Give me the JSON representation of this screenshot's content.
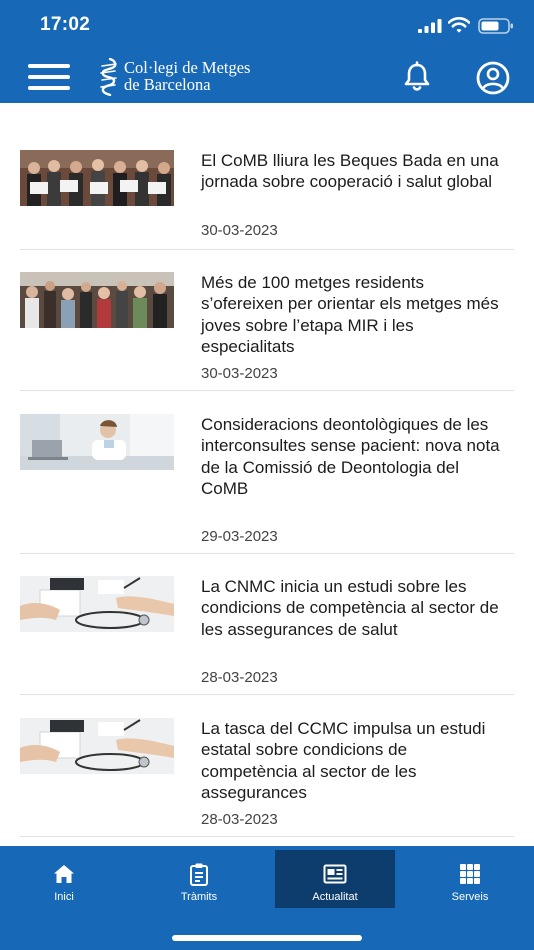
{
  "status_bar": {
    "time": "17:02"
  },
  "header": {
    "logo_line1": "Col·legi de Metges",
    "logo_line2": "de Barcelona",
    "menu_icon": "hamburger-menu-icon",
    "bell_icon": "bell-icon",
    "account_icon": "account-icon"
  },
  "news": [
    {
      "title": "El CoMB lliura les Beques Bada en una jornada sobre cooperació i salut global",
      "date": "30-03-2023"
    },
    {
      "title": "Més de 100 metges residents s’ofereixen per orientar els metges més joves sobre l’etapa MIR i les especialitats",
      "date": "30-03-2023"
    },
    {
      "title": "Consideracions deontològiques de les interconsultes sense pacient: nova nota de la Comissió de Deontologia del CoMB",
      "date": "29-03-2023"
    },
    {
      "title": "La CNMC inicia un estudi sobre les condicions de competència al sector de les assegurances de salut",
      "date": "28-03-2023"
    },
    {
      "title": "La tasca del CCMC impulsa un estudi estatal sobre condicions de competència al sector de les assegurances",
      "date": "28-03-2023"
    }
  ],
  "tabs": [
    {
      "label": "Inici",
      "icon": "home-icon"
    },
    {
      "label": "Tràmits",
      "icon": "clipboard-icon"
    },
    {
      "label": "Actualitat",
      "icon": "newspaper-icon",
      "active": true
    },
    {
      "label": "Serveis",
      "icon": "grid-icon"
    }
  ],
  "colors": {
    "brand": "#1769b7",
    "active_tab": "#0d3d6d"
  }
}
